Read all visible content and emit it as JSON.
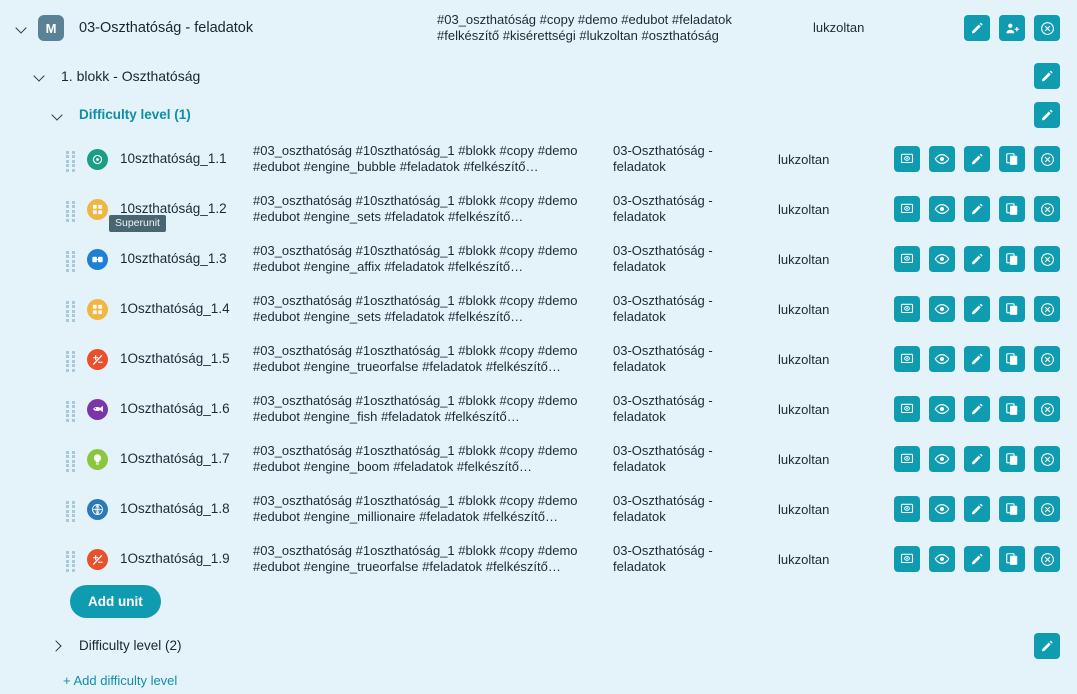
{
  "colors": {
    "background": "#e4f2fa",
    "accent": "#0f9bb0",
    "accent_text": "#0f8fa3",
    "link": "#1190a8",
    "badge": "#5b8196",
    "tooltip_bg": "#4a6572"
  },
  "module": {
    "badge_label": "M",
    "title": "03-Oszthatóság - feladatok",
    "tags": "#03_oszthatóság #copy #demo #edubot #feladatok #felkészítő #kisérettségi #lukzoltan #oszthatóság",
    "owner": "lukzoltan",
    "actions": [
      {
        "name": "edit-button",
        "icon": "pencil-icon",
        "title": "Edit"
      },
      {
        "name": "share-button",
        "icon": "add-user-icon",
        "title": "Share"
      },
      {
        "name": "remove-button",
        "icon": "close-circle-icon",
        "title": "Remove"
      }
    ]
  },
  "block": {
    "title": "1. blokk - Oszthatóság",
    "expanded": true,
    "edit_label": "",
    "edit_icon": "pencil-icon"
  },
  "difficulty_levels": [
    {
      "title": "Difficulty level (1)",
      "expanded": true,
      "active": true,
      "edit_icon": "pencil-icon"
    },
    {
      "title": "Difficulty level (2)",
      "expanded": false,
      "active": false,
      "edit_icon": "pencil-icon"
    }
  ],
  "unit_actions": [
    {
      "name": "present-button",
      "icon": "presentation-icon"
    },
    {
      "name": "preview-button",
      "icon": "eye-icon"
    },
    {
      "name": "edit-button",
      "icon": "pencil-icon"
    },
    {
      "name": "duplicate-button",
      "icon": "copy-icon"
    },
    {
      "name": "remove-button",
      "icon": "close-circle-icon"
    }
  ],
  "units": [
    {
      "name": "10szthatóság_1.1",
      "tags": "#03_oszthatóság #10szthatóság_1 #blokk #copy #demo #edubot #engine_bubble #feladatok #felkészítő…",
      "parent": "03-Oszthatóság - feladatok",
      "owner": "lukzoltan",
      "engine": "engine_bubble",
      "engine_icon": "bubble-icon",
      "engine_color": "#1a9e86",
      "tooltip": ""
    },
    {
      "name": "10szthatóság_1.2",
      "tags": "#03_oszthatóság #10szthatóság_1 #blokk #copy #demo #edubot #engine_sets #feladatok #felkészítő…",
      "parent": "03-Oszthatóság - feladatok",
      "owner": "lukzoltan",
      "engine": "engine_sets",
      "engine_icon": "sets-grid-icon",
      "engine_color": "#f0b642",
      "tooltip": "Superunit"
    },
    {
      "name": "10szthatóság_1.3",
      "tags": "#03_oszthatóság #10szthatóság_1 #blokk #copy #demo #edubot #engine_affix #feladatok #felkészítő…",
      "parent": "03-Oszthatóság - feladatok",
      "owner": "lukzoltan",
      "engine": "engine_affix",
      "engine_icon": "affix-icon",
      "engine_color": "#1e7fd4",
      "tooltip": ""
    },
    {
      "name": "1Oszthatóság_1.4",
      "tags": "#03_oszthatóság #1oszthatóság_1 #blokk #copy #demo #edubot #engine_sets #feladatok #felkészítő…",
      "parent": "03-Oszthatóság - feladatok",
      "owner": "lukzoltan",
      "engine": "engine_sets",
      "engine_icon": "sets-grid-icon",
      "engine_color": "#f0b642",
      "tooltip": ""
    },
    {
      "name": "1Oszthatóság_1.5",
      "tags": "#03_oszthatóság #1oszthatóság_1 #blokk #copy #demo #edubot #engine_trueorfalse #feladatok #felkészítő…",
      "parent": "03-Oszthatóság - feladatok",
      "owner": "lukzoltan",
      "engine": "engine_trueorfalse",
      "engine_icon": "true-false-icon",
      "engine_color": "#e8512b",
      "tooltip": ""
    },
    {
      "name": "1Oszthatóság_1.6",
      "tags": "#03_oszthatóság #1oszthatóság_1 #blokk #copy #demo #edubot #engine_fish #feladatok #felkészítő…",
      "parent": "03-Oszthatóság - feladatok",
      "owner": "lukzoltan",
      "engine": "engine_fish",
      "engine_icon": "fish-icon",
      "engine_color": "#7b35a8",
      "tooltip": ""
    },
    {
      "name": "1Oszthatóság_1.7",
      "tags": "#03_oszthatóság #1oszthatóság_1 #blokk #copy #demo #edubot #engine_boom #feladatok #felkészítő…",
      "parent": "03-Oszthatóság - feladatok",
      "owner": "lukzoltan",
      "engine": "engine_boom",
      "engine_icon": "lightbulb-icon",
      "engine_color": "#8cc63e",
      "tooltip": ""
    },
    {
      "name": "1Oszthatóság_1.8",
      "tags": "#03_oszthatóság #1oszthatóság_1 #blokk #copy #demo #edubot #engine_millionaire #feladatok #felkészítő…",
      "parent": "03-Oszthatóság - feladatok",
      "owner": "lukzoltan",
      "engine": "engine_millionaire",
      "engine_icon": "millionaire-grid-icon",
      "engine_color": "#2b79b8",
      "tooltip": ""
    },
    {
      "name": "1Oszthatóság_1.9",
      "tags": "#03_oszthatóság #1oszthatóság_1 #blokk #copy #demo #edubot #engine_trueorfalse #feladatok #felkészítő…",
      "parent": "03-Oszthatóság - feladatok",
      "owner": "lukzoltan",
      "engine": "engine_trueorfalse",
      "engine_icon": "true-false-icon",
      "engine_color": "#e8512b",
      "tooltip": ""
    }
  ],
  "buttons": {
    "add_unit": "Add unit",
    "add_difficulty_level": "+ Add difficulty level"
  }
}
